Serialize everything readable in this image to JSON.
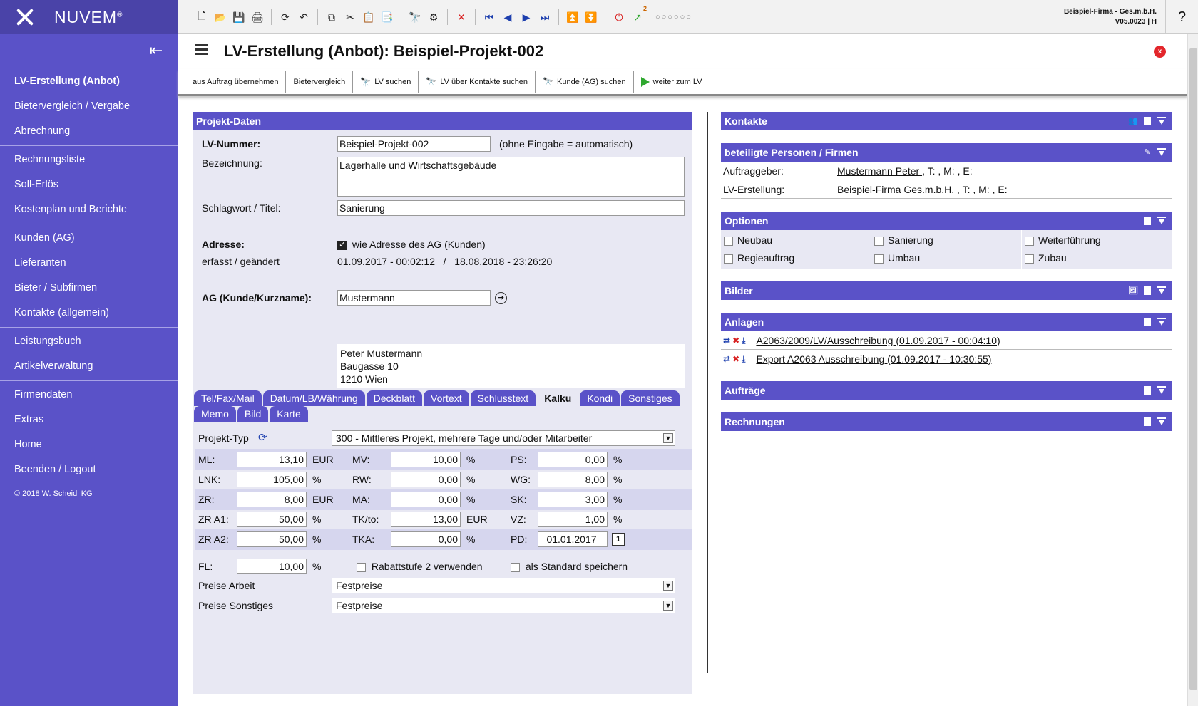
{
  "brand": {
    "name": "NUVEM",
    "reg": "®"
  },
  "sidebar": {
    "groups": [
      [
        "LV-Erstellung (Anbot)",
        "Bietervergleich / Vergabe",
        "Abrechnung"
      ],
      [
        "Rechnungsliste",
        "Soll-Erlös",
        "Kostenplan und Berichte"
      ],
      [
        "Kunden (AG)",
        "Lieferanten",
        "Bieter / Subfirmen",
        "Kontakte (allgemein)"
      ],
      [
        "Leistungsbuch",
        "Artikelverwaltung"
      ],
      [
        "Firmendaten",
        "Extras",
        "Home",
        "Beenden / Logout"
      ]
    ],
    "copyright": "© 2018 W. Scheidl KG"
  },
  "topbar": {
    "company": "Beispiel-Firma - Ges.m.b.H.",
    "version": "V05.0023 | H",
    "help": "?",
    "badge": "2",
    "dots": "○○○○○○"
  },
  "title": {
    "text": "LV-Erstellung (Anbot): Beispiel-Projekt-002",
    "close": "x"
  },
  "actions": [
    "aus Auftrag übernehmen",
    "Bietervergleich",
    "LV suchen",
    "LV über Kontakte suchen",
    "Kunde (AG) suchen",
    "weiter zum LV"
  ],
  "projekt": {
    "header": "Projekt-Daten",
    "lv_label": "LV-Nummer:",
    "lv_value": "Beispiel-Projekt-002",
    "lv_note": "(ohne Eingabe = automatisch)",
    "bez_label": "Bezeichnung:",
    "bez_value": "Lagerhalle und Wirtschaftsgebäude",
    "schlag_label": "Schlagwort / Titel:",
    "schlag_value": "Sanierung",
    "adresse_label": "Adresse:",
    "adresse_check": "wie Adresse des AG (Kunden)",
    "erfasst_label": "erfasst / geändert",
    "erfasst_value": "01.09.2017 - 00:02:12   /   18.08.2018 - 23:26:20",
    "ag_label": "AG (Kunde/Kurzname):",
    "ag_value": "Mustermann",
    "address_lines": [
      "Peter Mustermann",
      "Baugasse 10",
      "1210 Wien"
    ]
  },
  "tabs": {
    "row1": [
      "Tel/Fax/Mail",
      "Datum/LB/Währung",
      "Deckblatt",
      "Vortext",
      "Schlusstext",
      "Kalku",
      "Kondi",
      "Sonstiges"
    ],
    "row2": [
      "Memo",
      "Bild",
      "Karte"
    ],
    "selected": "Kalku"
  },
  "kalku": {
    "projekt_typ_label": "Projekt-Typ",
    "projekt_typ_value": "300 - Mittleres Projekt, mehrere Tage und/oder Mitarbeiter",
    "rows": [
      [
        {
          "l": "ML:",
          "v": "13,10",
          "u": "EUR"
        },
        {
          "l": "MV:",
          "v": "10,00",
          "u": "%"
        },
        {
          "l": "PS:",
          "v": "0,00",
          "u": "%"
        }
      ],
      [
        {
          "l": "LNK:",
          "v": "105,00",
          "u": "%"
        },
        {
          "l": "RW:",
          "v": "0,00",
          "u": "%"
        },
        {
          "l": "WG:",
          "v": "8,00",
          "u": "%"
        }
      ],
      [
        {
          "l": "ZR:",
          "v": "8,00",
          "u": "EUR"
        },
        {
          "l": "MA:",
          "v": "0,00",
          "u": "%"
        },
        {
          "l": "SK:",
          "v": "3,00",
          "u": "%"
        }
      ],
      [
        {
          "l": "ZR A1:",
          "v": "50,00",
          "u": "%"
        },
        {
          "l": "TK/to:",
          "v": "13,00",
          "u": "EUR"
        },
        {
          "l": "VZ:",
          "v": "1,00",
          "u": "%"
        }
      ],
      [
        {
          "l": "ZR A2:",
          "v": "50,00",
          "u": "%"
        },
        {
          "l": "TKA:",
          "v": "0,00",
          "u": "%"
        },
        {
          "l": "PD:",
          "v": "01.01.2017",
          "u": "1"
        }
      ]
    ],
    "fl_label": "FL:",
    "fl_value": "10,00",
    "fl_unit": "%",
    "rabatt": "Rabattstufe 2 verwenden",
    "standard": "als Standard speichern",
    "preise_arbeit_label": "Preise Arbeit",
    "preise_arbeit_value": "Festpreise",
    "preise_sonst_label": "Preise Sonstiges",
    "preise_sonst_value": "Festpreise"
  },
  "right": {
    "kontakte": "Kontakte",
    "beteiligte": "beteiligte Personen / Firmen",
    "auftraggeber_label": "Auftraggeber:",
    "auftraggeber_name": "Mustermann Peter ",
    "auftraggeber_rest": ", T: , M: , E:",
    "lverst_label": "LV-Erstellung:",
    "lverst_name": "Beispiel-Firma Ges.m.b.H. ",
    "lverst_rest": ", T: , M: , E:",
    "optionen": "Optionen",
    "options": [
      [
        "Neubau",
        "Regieauftrag"
      ],
      [
        "Sanierung",
        "Umbau"
      ],
      [
        "Weiterführung",
        "Zubau"
      ]
    ],
    "bilder": "Bilder",
    "anlagen": "Anlagen",
    "files": [
      "A2063/2009/LV/Ausschreibung (01.09.2017 - 00:04:10)",
      "Export A2063 Ausschreibung (01.09.2017 - 10:30:55)"
    ],
    "auftraege": "Aufträge",
    "rechnungen": "Rechnungen"
  }
}
